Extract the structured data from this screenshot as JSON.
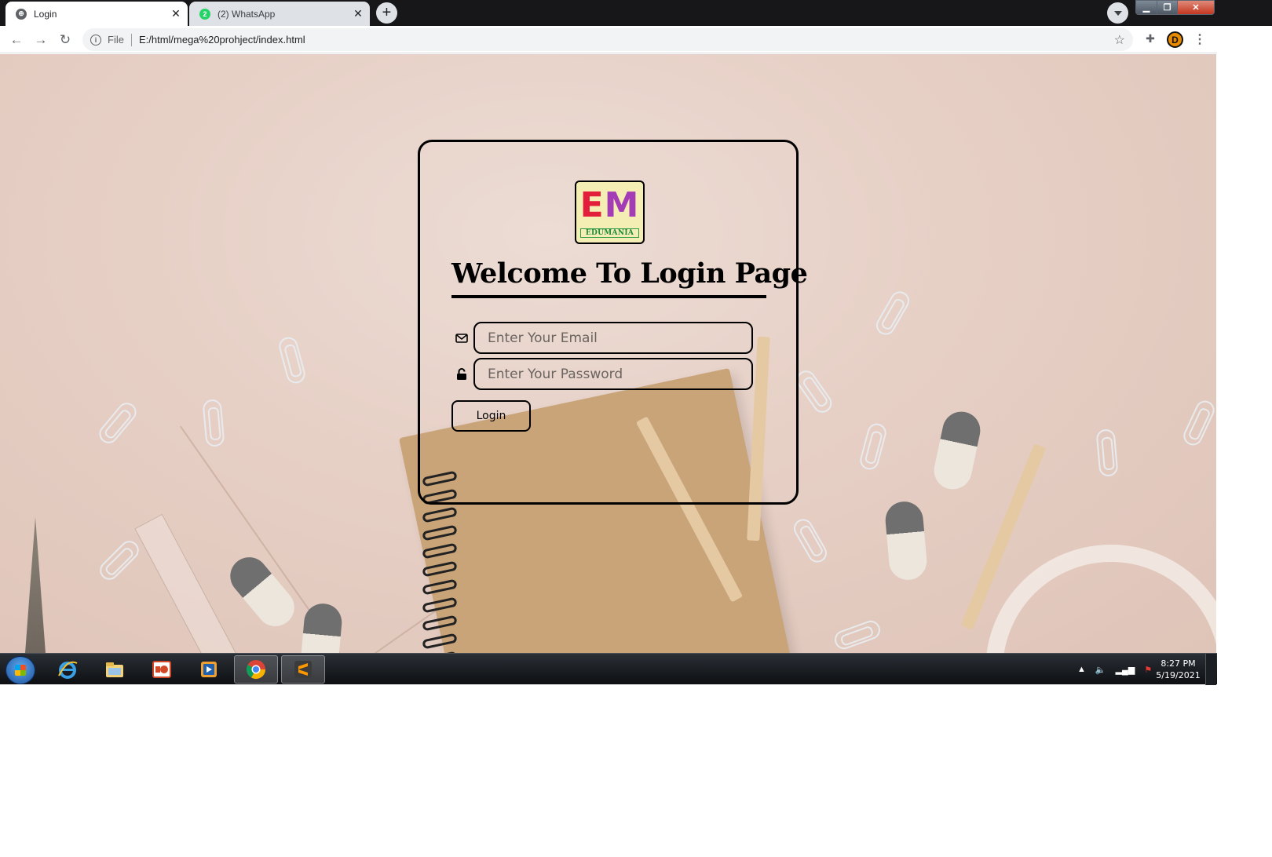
{
  "browser": {
    "tabs": [
      {
        "title": "Login",
        "favicon": "globe-icon",
        "active": true
      },
      {
        "title": "(2) WhatsApp",
        "favicon": "whatsapp-icon",
        "badge": "2",
        "active": false
      }
    ],
    "new_tab_label": "+",
    "address": {
      "scheme": "File",
      "url": "E:/html/mega%20prohject/index.html"
    },
    "avatar_letter": "D",
    "colors": {
      "tabbar": "#17171a",
      "toolbar": "#ffffff",
      "omnibox": "#f1f3f4"
    }
  },
  "login": {
    "logo": {
      "letter_e": "E",
      "letter_m": "M",
      "word": "EDUMANIA"
    },
    "heading": "Welcome To Login Page",
    "email": {
      "placeholder": "Enter Your Email",
      "value": "",
      "icon": "envelope-icon"
    },
    "password": {
      "placeholder": "Enter Your Password",
      "value": "",
      "icon": "lock-icon"
    },
    "button_label": "Login"
  },
  "taskbar": {
    "items": [
      "internet-explorer-icon",
      "file-explorer-icon",
      "powerpoint-icon",
      "media-player-icon",
      "chrome-icon",
      "sublime-text-icon"
    ],
    "active_item": "chrome-icon",
    "clock": {
      "time": "8:27 PM",
      "date": "5/19/2021"
    }
  }
}
